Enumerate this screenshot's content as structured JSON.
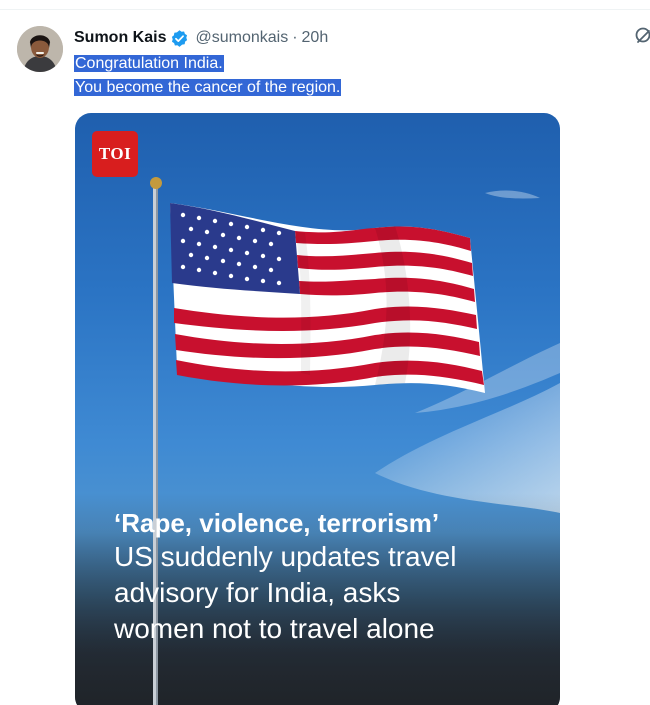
{
  "author": {
    "name": "Sumon Kais",
    "handle": "@sumonkais",
    "separator": "·",
    "time": "20h",
    "verified": true
  },
  "tweet": {
    "lines": [
      "Congratulation India.",
      "You become the cancer of the region."
    ],
    "selection_color": "#3367d6"
  },
  "media": {
    "badge": "TOI",
    "badge_color": "#d81e1e",
    "headline_bold": "‘Rape, violence, terrorism’",
    "headline_lines": [
      "US suddenly updates travel",
      "advisory for India, asks",
      "women not to travel alone"
    ]
  },
  "icons": {
    "avatar": "avatar",
    "verified": "verified-badge-icon",
    "grok": "grok-icon"
  }
}
